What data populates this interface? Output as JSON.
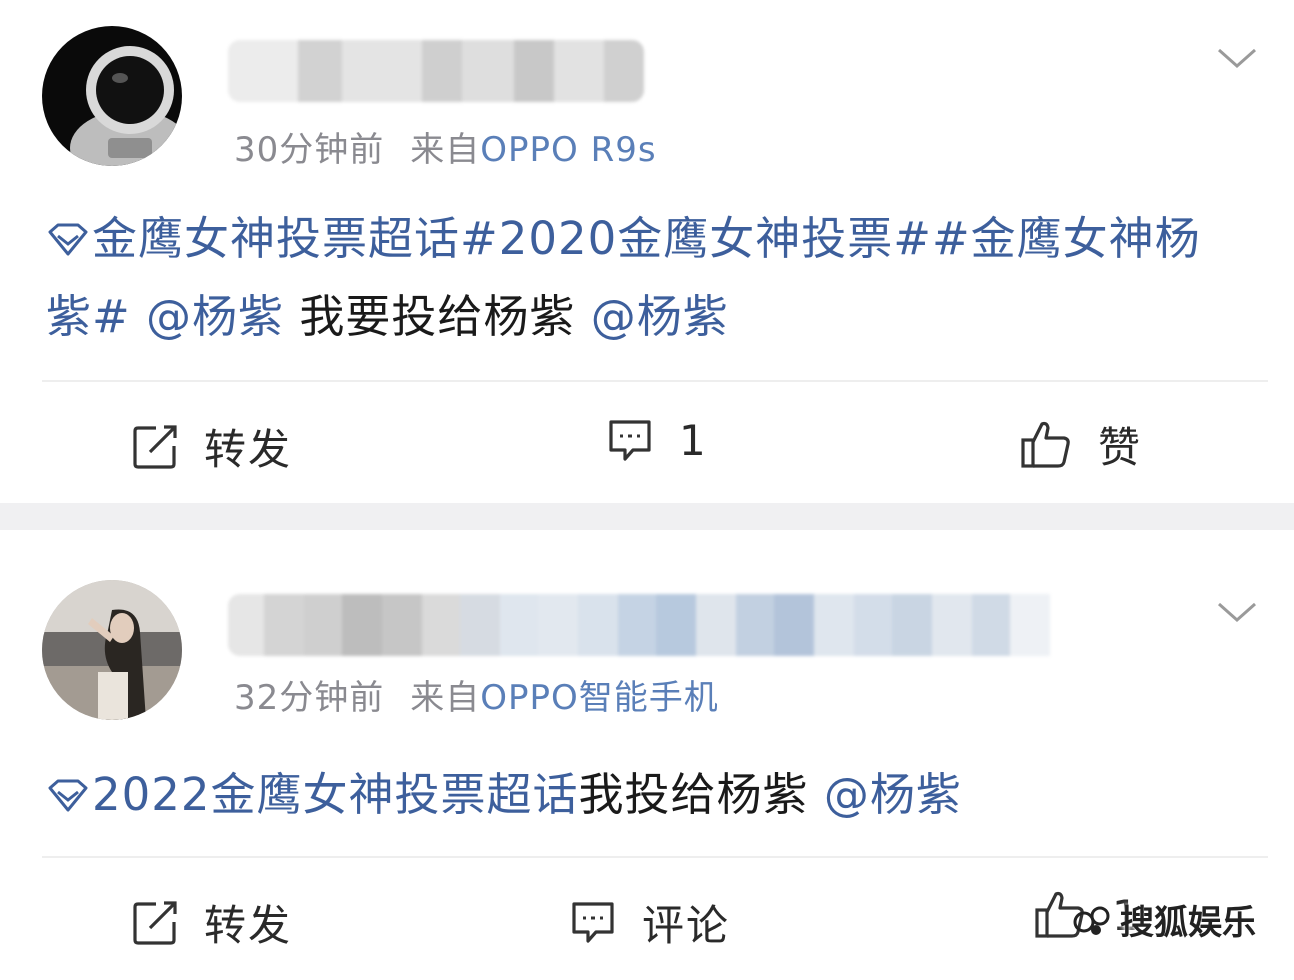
{
  "feed": {
    "posts": [
      {
        "time": "30分钟前",
        "source_prefix": "来自",
        "device": "OPPO R9s",
        "content": {
          "topic1": "金鹰女神投票超话",
          "hashtag1": "#2020金鹰女神投票#",
          "hashtag2": "#金鹰女神杨紫#",
          "mention1": "@杨紫",
          "text": "我要投给杨紫",
          "mention2": "@杨紫"
        },
        "actions": {
          "repost": "转发",
          "comment": "1",
          "like": "赞"
        }
      },
      {
        "time": "32分钟前",
        "source_prefix": "来自",
        "device": "OPPO智能手机",
        "content": {
          "topic1": "2022金鹰女神投票超话",
          "text": "我投给杨紫",
          "mention1": "@杨紫"
        },
        "actions": {
          "repost": "转发",
          "comment": "评论",
          "like": "1"
        }
      }
    ]
  },
  "watermark": {
    "text": "搜狐娱乐",
    "icon": "sohu-logo-icon"
  },
  "colors": {
    "link": "#3d5f9c",
    "meta": "#8a8a90",
    "device": "#5a7fb8",
    "text": "#1a1a1a",
    "separator": "#f0f0f2"
  }
}
